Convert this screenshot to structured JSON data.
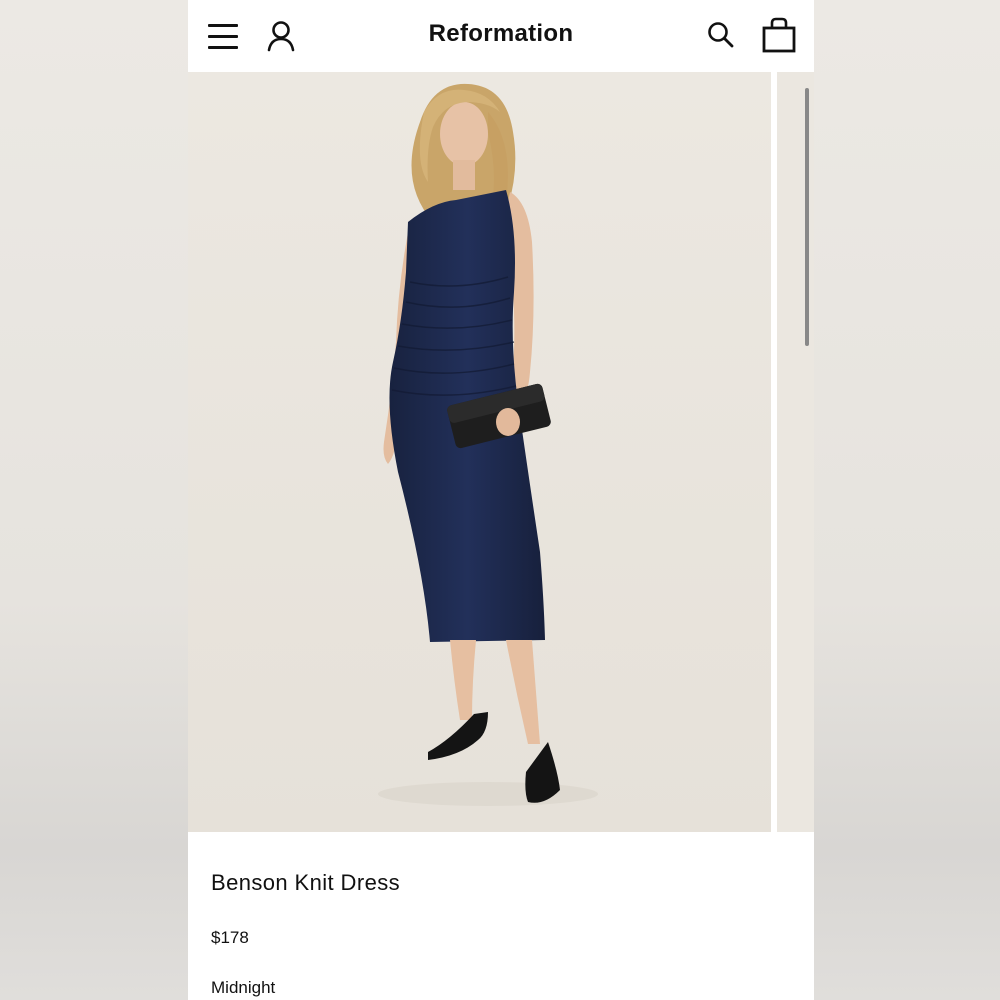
{
  "header": {
    "brand": "Reformation",
    "icons": {
      "menu": "menu-icon",
      "account": "account-icon",
      "search": "search-icon",
      "bag": "bag-icon"
    }
  },
  "gallery": {
    "main_image": "product-photo-model-navy-dress",
    "next_image": "product-photo-next"
  },
  "product": {
    "name": "Benson Knit Dress",
    "price": "$178",
    "color": "Midnight"
  },
  "colors": {
    "dress": "#1c2748",
    "background": "#ebe7e0",
    "text": "#111111"
  }
}
